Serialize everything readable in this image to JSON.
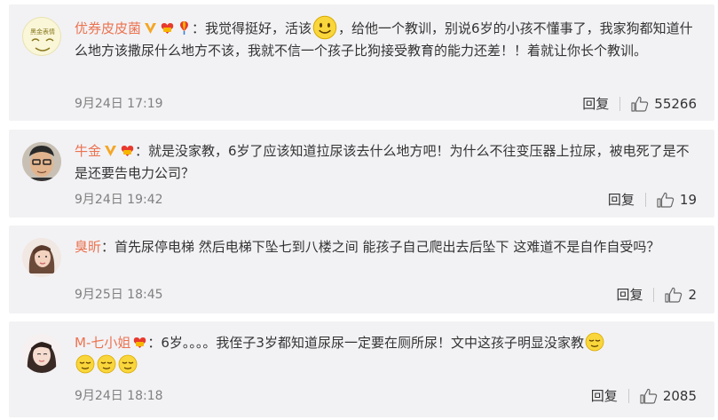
{
  "comments": [
    {
      "username": "优券皮皮菌",
      "text_part1": "：我觉得挺好，活该",
      "text_part2": "，给他一个教训，别说6岁的小孩不懂事了，我家狗都知道什么地方该撒尿什么地方不该，我就不信一个孩子比狗接受教育的能力还差！！着就让你长个教训。",
      "time": "9月24日 17:19",
      "reply_label": "回复",
      "like_count": "55266",
      "avatar_text": "黑金表情"
    },
    {
      "username": "牛金",
      "text_part1": "：就是没家教，6岁了应该知道拉尿该去什么地方吧！为什么不往变压器上拉尿，被电死了是不是还要告电力公司？",
      "time": "9月24日 19:42",
      "reply_label": "回复",
      "like_count": "19"
    },
    {
      "username": "臭昕",
      "text_part1": "：首先尿停电梯 然后电梯下坠七到八楼之间 能孩子自己爬出去后坠下 这难道不是自作自受吗？",
      "time": "9月25日 18:45",
      "reply_label": "回复",
      "like_count": "2"
    },
    {
      "username": "M-七小姐",
      "text_part1": "：6岁。。。。我侄子3岁都知道尿尿一定要在厕所尿！文中这孩子明显没家教",
      "time": "9月24日 18:18",
      "reply_label": "回复",
      "like_count": "2085"
    }
  ],
  "colors": {
    "username": "#eb7350",
    "card_bg": "#f2f2f5",
    "meta": "#808080",
    "badge_v": "#f5a623"
  },
  "icons": [
    "vip-v-icon",
    "level-badge-icon",
    "balloon-icon",
    "smile-emoji",
    "thumbs-up-icon",
    "relieved-emoji"
  ]
}
